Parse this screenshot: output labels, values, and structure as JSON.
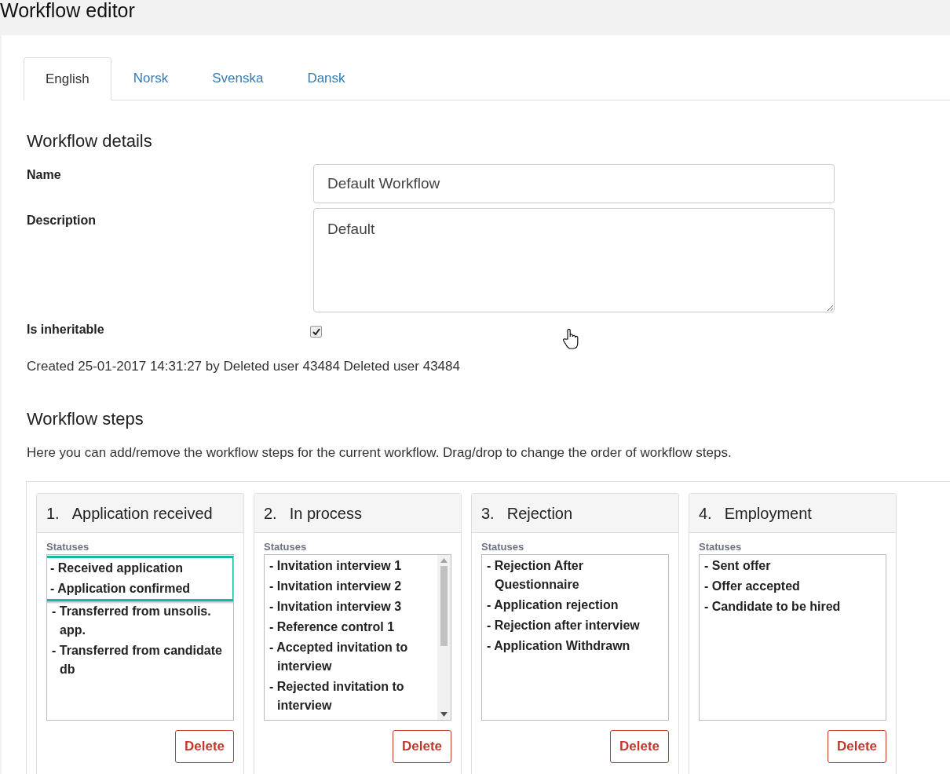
{
  "page": {
    "title": "Workflow editor"
  },
  "tabs": [
    {
      "label": "English",
      "selected": true
    },
    {
      "label": "Norsk",
      "selected": false
    },
    {
      "label": "Svenska",
      "selected": false
    },
    {
      "label": "Dansk",
      "selected": false
    }
  ],
  "details": {
    "heading": "Workflow details",
    "name": {
      "label": "Name",
      "value": "Default Workflow"
    },
    "description": {
      "label": "Description",
      "value": "Default"
    },
    "inheritable": {
      "label": "Is inheritable",
      "checked": true
    },
    "created": "Created 25-01-2017 14:31:27 by Deleted user 43484 Deleted user 43484"
  },
  "steps_section": {
    "heading": "Workflow steps",
    "intro": "Here you can add/remove the workflow steps for the current workflow. Drag/drop to change the order of workflow steps."
  },
  "steps": [
    {
      "number": "1.",
      "title": "Application received",
      "statuses_label": "Statuses",
      "scrollable": false,
      "delete": "Delete",
      "statuses": [
        {
          "text": "- Received application",
          "highlighted": true
        },
        {
          "text": "- Application confirmed",
          "highlighted": true
        },
        {
          "text": "- Transferred from unsolis. app.",
          "highlighted": false
        },
        {
          "text": "- Transferred from candidate db",
          "highlighted": false
        }
      ]
    },
    {
      "number": "2.",
      "title": "In process",
      "statuses_label": "Statuses",
      "scrollable": true,
      "delete": "Delete",
      "statuses": [
        {
          "text": "- Invitation interview 1",
          "highlighted": false
        },
        {
          "text": "- Invitation interview 2",
          "highlighted": false
        },
        {
          "text": "- Invitation interview 3",
          "highlighted": false
        },
        {
          "text": "- Reference control 1",
          "highlighted": false
        },
        {
          "text": "- Accepted invitation to interview",
          "highlighted": false
        },
        {
          "text": "- Rejected invitation to interview",
          "highlighted": false
        }
      ]
    },
    {
      "number": "3.",
      "title": "Rejection",
      "statuses_label": "Statuses",
      "scrollable": false,
      "delete": "Delete",
      "statuses": [
        {
          "text": "- Rejection After Questionnaire",
          "highlighted": false
        },
        {
          "text": "- Application rejection",
          "highlighted": false
        },
        {
          "text": "- Rejection after interview",
          "highlighted": false
        },
        {
          "text": "- Application Withdrawn",
          "highlighted": false
        }
      ]
    },
    {
      "number": "4.",
      "title": "Employment",
      "statuses_label": "Statuses",
      "scrollable": false,
      "delete": "Delete",
      "statuses": [
        {
          "text": "- Sent offer",
          "highlighted": false
        },
        {
          "text": "- Offer accepted",
          "highlighted": false
        },
        {
          "text": "- Candidate to be hired",
          "highlighted": false
        }
      ]
    }
  ]
}
